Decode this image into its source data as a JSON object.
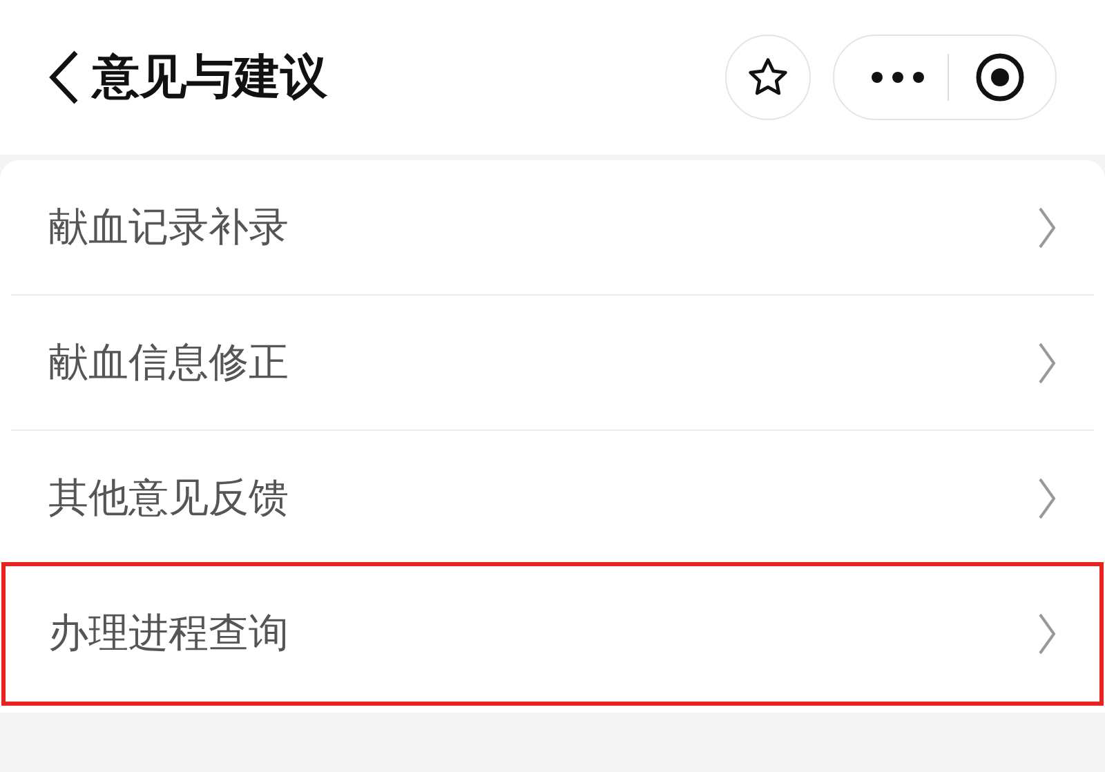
{
  "header": {
    "title": "意见与建议"
  },
  "items": [
    {
      "label": "献血记录补录",
      "highlighted": false
    },
    {
      "label": "献血信息修正",
      "highlighted": false
    },
    {
      "label": "其他意见反馈",
      "highlighted": false
    },
    {
      "label": "办理进程查询",
      "highlighted": true
    }
  ]
}
